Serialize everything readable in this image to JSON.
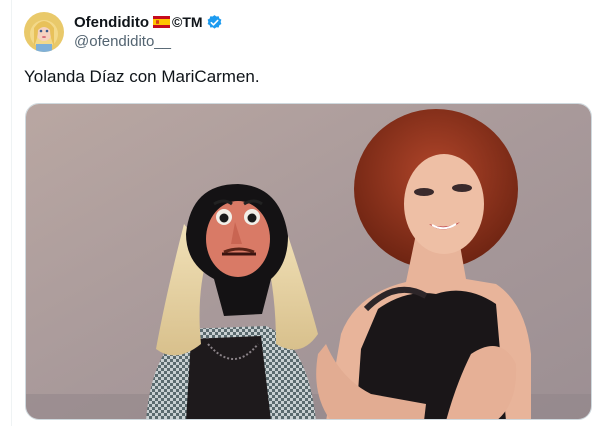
{
  "tweet": {
    "author": {
      "display_name": "Ofendidito",
      "name_suffix": "©TM",
      "handle": "@ofendidito__",
      "avatar_icon": "avatar-doll-icon",
      "flag_icon": "spain-flag-icon",
      "verified_icon": "verified-badge-icon",
      "verified_color": "#1d9bf0"
    },
    "text": "Yolanda Díaz con MariCarmen.",
    "media": {
      "icon": "photo-image"
    }
  },
  "colors": {
    "text_primary": "#0f1419",
    "text_secondary": "#536471",
    "border": "#cfd9de"
  }
}
